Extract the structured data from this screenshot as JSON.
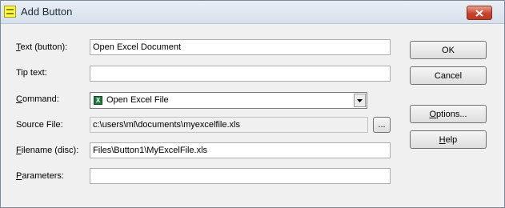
{
  "window": {
    "title": "Add Button",
    "icon": "app-icon",
    "close_icon": "close-icon"
  },
  "form": {
    "text_label": "Text (button):",
    "text_value": "Open Excel Document",
    "tip_label": "Tip text:",
    "tip_value": "",
    "command_label": "Command:",
    "command_value": "Open Excel File",
    "command_icon": "excel-icon",
    "source_label": "Source File:",
    "source_value": "c:\\users\\ml\\documents\\myexcelfile.xls",
    "browse_label": "...",
    "filename_label": "Filename (disc):",
    "filename_value": "Files\\Button1\\MyExcelFile.xls",
    "parameters_label": "Parameters:",
    "parameters_value": ""
  },
  "buttons": {
    "ok": "OK",
    "cancel": "Cancel",
    "options": "Options...",
    "help": "Help"
  }
}
